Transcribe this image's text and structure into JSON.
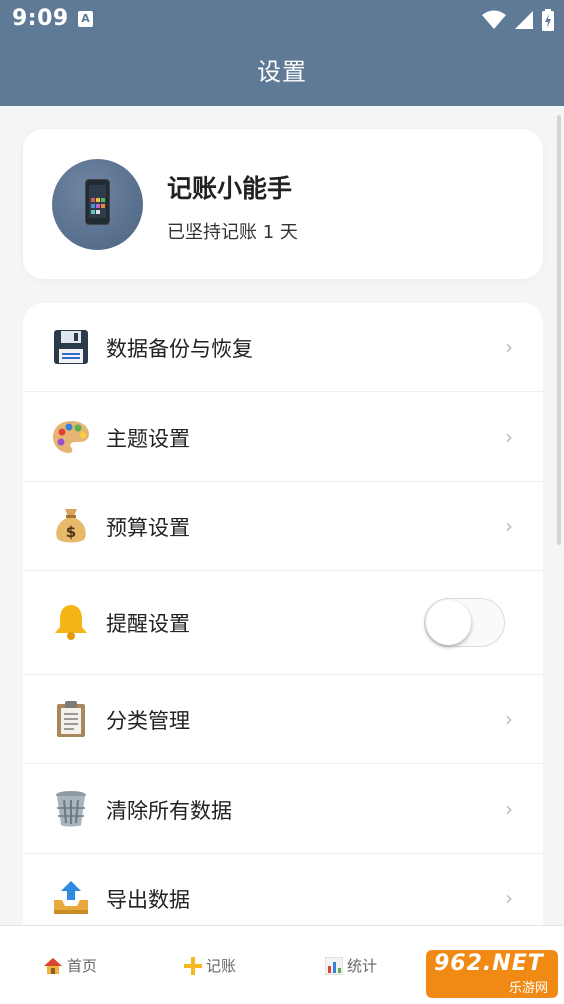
{
  "status": {
    "time": "9:09",
    "notification_glyph": "A"
  },
  "header": {
    "title": "设置"
  },
  "profile": {
    "name": "记账小能手",
    "days_text": "已坚持记账 1 天",
    "avatar_icon": "smartphone-icon"
  },
  "menu": {
    "items": [
      {
        "label": "数据备份与恢复",
        "icon": "floppy-disk-icon",
        "chevron": "›"
      },
      {
        "label": "主题设置",
        "icon": "palette-icon",
        "chevron": "›"
      },
      {
        "label": "预算设置",
        "icon": "money-bag-icon",
        "chevron": "›"
      },
      {
        "label": "提醒设置",
        "icon": "bell-icon",
        "toggle_on": false
      },
      {
        "label": "分类管理",
        "icon": "clipboard-icon",
        "chevron": "›"
      },
      {
        "label": "清除所有数据",
        "icon": "wastebasket-icon",
        "chevron": "›"
      },
      {
        "label": "导出数据",
        "icon": "outbox-tray-icon",
        "chevron": "›"
      }
    ]
  },
  "nav": {
    "items": [
      {
        "label": "首页",
        "icon": "house-icon"
      },
      {
        "label": "记账",
        "icon": "plus-icon"
      },
      {
        "label": "统计",
        "icon": "bar-chart-icon"
      }
    ]
  },
  "watermark": {
    "top": "962.NET",
    "bottom": "乐游网"
  },
  "colors": {
    "header": "#5e7a97",
    "accent_plus": "#f5b820"
  }
}
